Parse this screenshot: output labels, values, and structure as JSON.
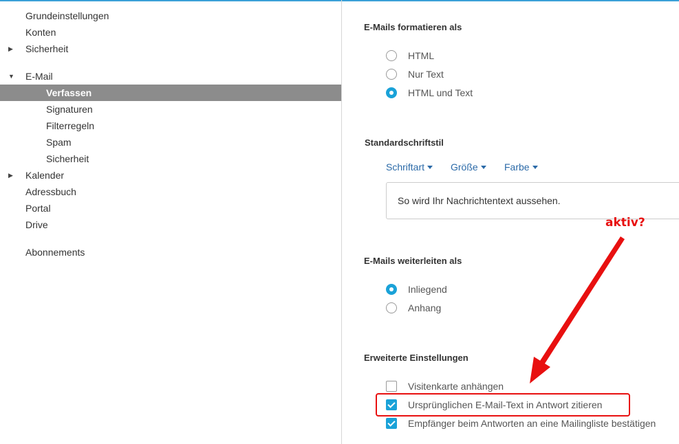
{
  "sidebar": {
    "items": [
      {
        "label": "Grundeinstellungen"
      },
      {
        "label": "Konten"
      },
      {
        "label": "Sicherheit"
      },
      {
        "label": "E-Mail"
      },
      {
        "label": "Verfassen"
      },
      {
        "label": "Signaturen"
      },
      {
        "label": "Filterregeln"
      },
      {
        "label": "Spam"
      },
      {
        "label": "Sicherheit"
      },
      {
        "label": "Kalender"
      },
      {
        "label": "Adressbuch"
      },
      {
        "label": "Portal"
      },
      {
        "label": "Drive"
      },
      {
        "label": "Abonnements"
      }
    ]
  },
  "main": {
    "format": {
      "title": "E-Mails formatieren als",
      "options": [
        {
          "label": "HTML",
          "selected": false
        },
        {
          "label": "Nur Text",
          "selected": false
        },
        {
          "label": "HTML und Text",
          "selected": true
        }
      ]
    },
    "font": {
      "title": "Standardschriftstil",
      "dropdowns": [
        {
          "label": "Schriftart"
        },
        {
          "label": "Größe"
        },
        {
          "label": "Farbe"
        }
      ],
      "preview": "So wird Ihr Nachrichtentext aussehen."
    },
    "forward": {
      "title": "E-Mails weiterleiten als",
      "options": [
        {
          "label": "Inliegend",
          "selected": true
        },
        {
          "label": "Anhang",
          "selected": false
        }
      ]
    },
    "advanced": {
      "title": "Erweiterte Einstellungen",
      "options": [
        {
          "label": "Visitenkarte anhängen",
          "checked": false
        },
        {
          "label": "Ursprünglichen E-Mail-Text in Antwort zitieren",
          "checked": true
        },
        {
          "label": "Empfänger beim Antworten an eine Mailingliste bestätigen",
          "checked": true
        }
      ]
    }
  },
  "annotation": {
    "text": "aktiv?",
    "color": "#e81010"
  },
  "colors": {
    "accent": "#1aa2d8",
    "selected_bg": "#8c8c8c",
    "link": "#2b6aa8"
  },
  "icons": {
    "caret_collapsed": "triangle-right",
    "caret_expanded": "triangle-down"
  }
}
